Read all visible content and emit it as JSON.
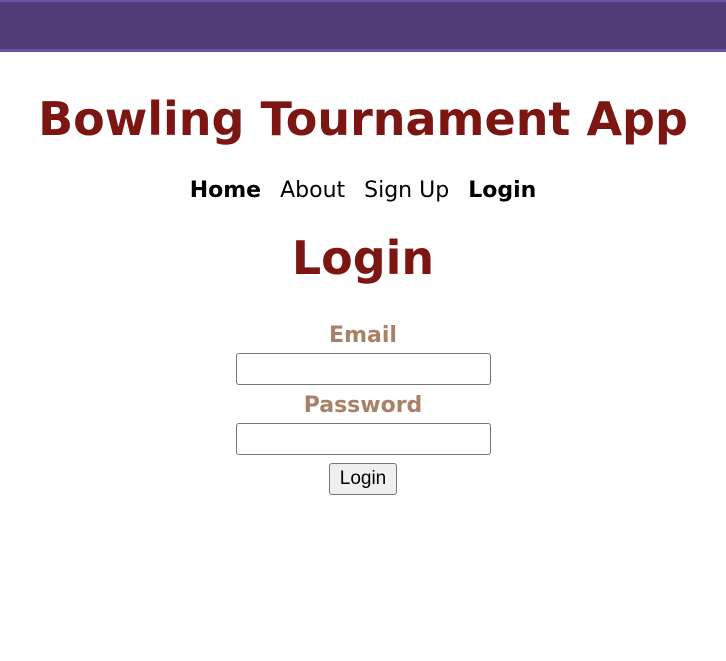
{
  "app_title": "Bowling Tournament App",
  "nav": {
    "home": "Home",
    "about": "About",
    "signup": "Sign Up",
    "login": "Login"
  },
  "page_title": "Login",
  "form": {
    "email_label": "Email",
    "email_value": "",
    "password_label": "Password",
    "password_value": "",
    "submit_label": "Login"
  },
  "colors": {
    "header_bar": "#523b79",
    "title": "#7b1612",
    "label": "#a98168"
  }
}
